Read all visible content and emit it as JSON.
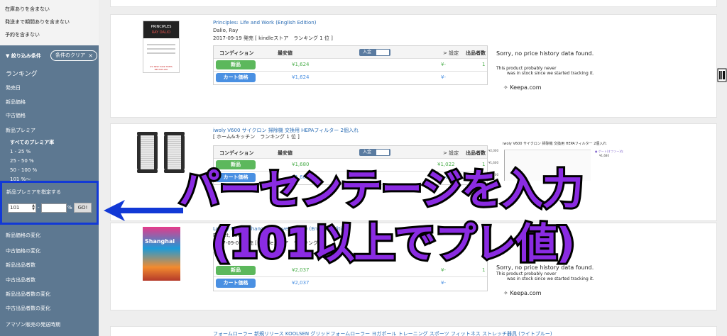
{
  "sidebar": {
    "top_items": [
      "在庫ありを含まない",
      "発送まで期間ありを含まない",
      "予約を含まない"
    ],
    "filter_header": "絞り込み条件",
    "clear_button": "条件のクリア",
    "clear_icon": "×",
    "items": [
      {
        "label": "ランキング"
      },
      {
        "label": "発売日"
      },
      {
        "label": "新品価格"
      },
      {
        "label": "中古価格"
      },
      {
        "label": "新品プレミア"
      }
    ],
    "premium_options": [
      "すべてのプレミア率",
      "1 - 25 %",
      "25 - 50 %",
      "50 - 100 %",
      "101 %～"
    ],
    "premium_custom": {
      "label": "新品プレミアを指定する",
      "from_value": "101",
      "separator": "-",
      "to_value": "",
      "unit": "%",
      "go_label": "GO!"
    },
    "items_below": [
      {
        "label": "新品価格の変化"
      },
      {
        "label": "中古価格の変化"
      },
      {
        "label": "新品出品者数"
      },
      {
        "label": "中古出品者数"
      },
      {
        "label": "新品出品者数の変化"
      },
      {
        "label": "中古出品者数の変化"
      },
      {
        "label": "アマゾン販売の発送時期"
      }
    ]
  },
  "table_headers": {
    "condition": "コンディション",
    "min_price": "最安値",
    "toggle": "入金",
    "settings": "> 設定",
    "count": "出品者数"
  },
  "products": [
    {
      "title": "Principles: Life and Work (English Edition)",
      "author": "Dalio, Ray",
      "meta": "2017-09-19 発売 [ kindleストア　ランキング 1 位 ]",
      "cover": {
        "title": "PRINCIPLES",
        "author": "RAY DALIO",
        "footer": "#1 NEW YORK TIMES BESTSELLER"
      },
      "rows": [
        {
          "label": "新品",
          "price": "¥1,624",
          "price2": "¥-",
          "count": "1"
        },
        {
          "label": "カート価格",
          "price": "¥1,624",
          "price2": "¥-",
          "count": ""
        }
      ],
      "no_history": "Sorry, no price history data found.",
      "no_history_note_1": "This product probably never",
      "no_history_note_2": "was in stock since we started tracking it.",
      "keepa": "✧ Keepa.com"
    },
    {
      "title": "iwoly V600 サイクロン 掃除機 交換用 HEPAフィルター 2個入れ",
      "meta": "[ ホーム&キッチン　ランキング 1 位 ]",
      "rows": [
        {
          "label": "新品",
          "price": "¥1,680",
          "price2": "¥1,022",
          "count": "1"
        },
        {
          "label": "カート価格",
          "price": "¥1,680",
          "price2": "¥1,022",
          "count": ""
        }
      ],
      "chart": {
        "title": "iwoly V600 サイクロン 掃除機 交換用 HEPAフィルター 2個入れ",
        "yticks": [
          "¥2,000",
          "¥1,600",
          "¥1,200"
        ],
        "legend": "ゲート(オファー)在",
        "legend_value": "¥1,680"
      }
    },
    {
      "title": "Lonely Planet Shanghai (Travel Guide) (English Edition)",
      "author": "Planet, Lonely",
      "meta": "2017-09-01 発売 [ kindleストア　ランキング ]",
      "cover_text": "Shanghai",
      "rows": [
        {
          "label": "新品",
          "price": "¥2,037",
          "price2": "¥-",
          "count": "1"
        },
        {
          "label": "カート価格",
          "price": "¥2,037",
          "price2": "¥-",
          "count": ""
        }
      ],
      "no_history": "Sorry, no price history data found.",
      "no_history_note_1": "This product probably never",
      "no_history_note_2": "was in stock since we started tracking it.",
      "keepa": "✧ Keepa.com"
    },
    {
      "title": "フォームローラー 新規リリース KOOLSEN グリッドフォームローラー ヨガポール トレーニング スポーツ フィットネス ストレッチ器具 (ライトブルー)"
    }
  ],
  "overlay": {
    "line1": "パーセンテージを入力",
    "line2": "(101以上でプレ値)",
    "color": "#8a2be2",
    "arrow_color": "#1239d6"
  },
  "right_edge_icon": "barcode-icon"
}
